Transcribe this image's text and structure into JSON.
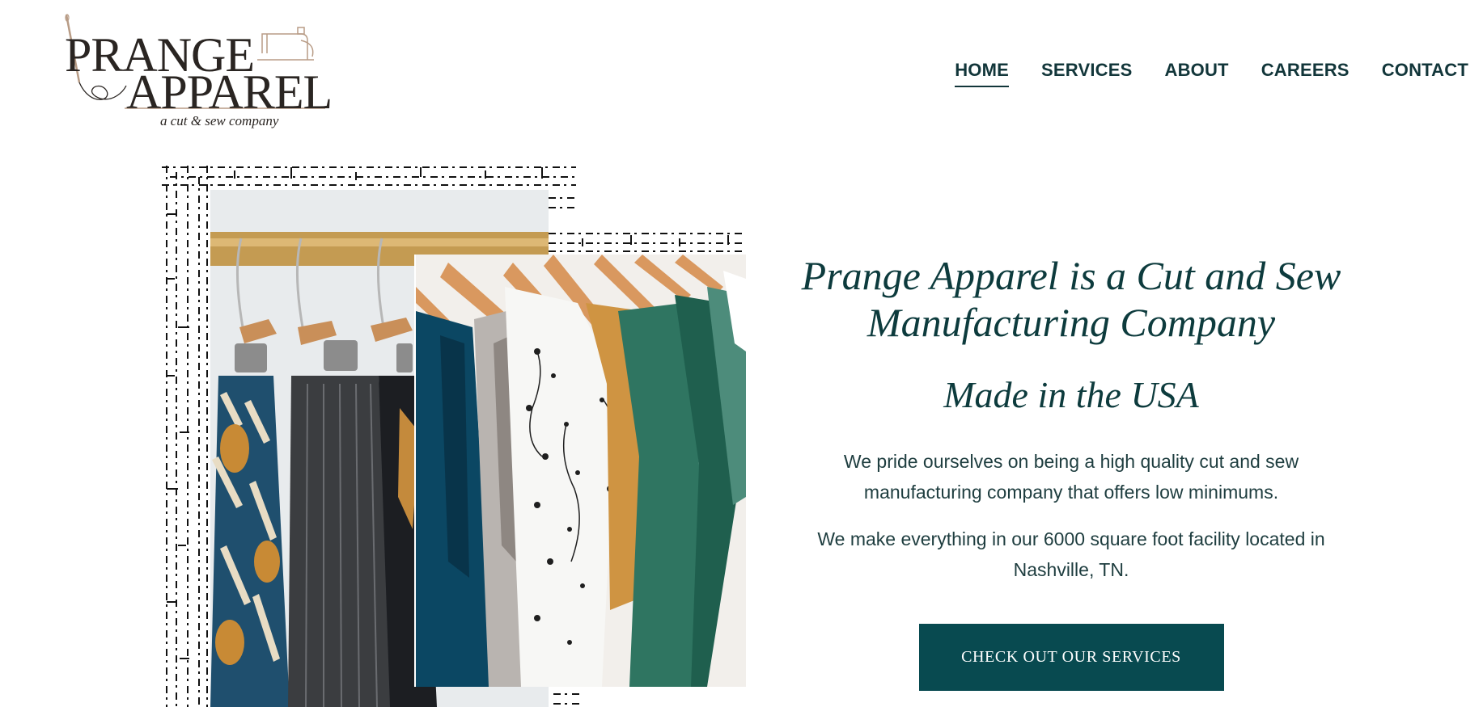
{
  "brand": {
    "line1": "PRANGE",
    "line2": "APPAREL",
    "tagline": "a cut & sew company"
  },
  "nav": {
    "items": [
      {
        "label": "HOME",
        "active": true
      },
      {
        "label": "SERVICES",
        "active": false
      },
      {
        "label": "ABOUT",
        "active": false
      },
      {
        "label": "CAREERS",
        "active": false
      },
      {
        "label": "CONTACT",
        "active": false
      }
    ]
  },
  "hero": {
    "title": "Prange Apparel is a Cut and Sew Manufacturing Company",
    "subtitle": "Made in the USA",
    "paragraph1": "We pride ourselves on being a high quality cut and sew manufacturing company that offers low minimums.",
    "paragraph2": "We make everything in our 6000 square foot facility located in Nashville, TN.",
    "cta_label": "CHECK OUT OUR SERVICES"
  },
  "colors": {
    "primary": "#084a50",
    "text": "#0d3b3d",
    "logo": "#2a2522",
    "logo_accent": "#b89c86"
  },
  "images": {
    "back_photo": "clothes-rack-hangers-photo",
    "front_photo": "hanging-garments-photo"
  }
}
